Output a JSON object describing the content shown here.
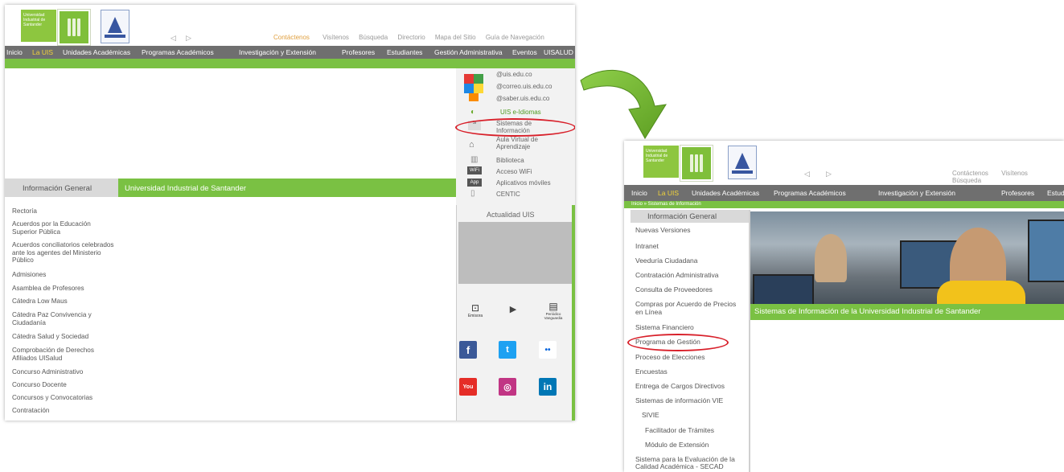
{
  "left": {
    "logo_text": "Universidad Industrial de Santander",
    "top_links": [
      "Contáctenos",
      "Visítenos",
      "Búsqueda",
      "Directorio",
      "Mapa del Sitio",
      "Guía de Navegación"
    ],
    "nav_items": [
      "Inicio",
      "La UIS",
      "Unidades Académicas",
      "Programas Académicos",
      "Investigación y Extensión",
      "Profesores",
      "Estudiantes",
      "Gestión Administrativa",
      "Eventos",
      "UISALUD"
    ],
    "side_title": "Información General",
    "main_title": "Universidad Industrial de Santander",
    "side_items": [
      "Rectoría",
      "Acuerdos por la Educación Superior Pública",
      "Acuerdos conciliatorios celebrados ante los agentes del Ministerio Público",
      "Admisiones",
      "Asamblea de Profesores",
      "Cátedra Low Maus",
      "Cátedra Paz Convivencia y Ciudadanía",
      "Cátedra Salud y Sociedad",
      "Comprobación de Derechos Afiliados UISalud",
      "Concurso Administrativo",
      "Concurso Docente",
      "Concursos y Convocatorias",
      "Contratación"
    ],
    "right_links": [
      "@uis.edu.co",
      "@correo.uis.edu.co",
      "@saber.uis.edu.co",
      "UIS e-Idiomas",
      "Sistemas de Información",
      "Aula Virtual de Aprendizaje",
      "Biblioteca",
      "Acceso WiFi",
      "Aplicativos móviles",
      "CENTIC"
    ],
    "actualidad": "Actualidad UIS",
    "media_labels": [
      "Emisora",
      "",
      "Periódico Vanguardia"
    ]
  },
  "right": {
    "logo_text": "Universidad Industrial de Santander",
    "top_links": [
      "Contáctenos",
      "Visítenos",
      "Búsqueda"
    ],
    "nav_items": [
      "Inicio",
      "La UIS",
      "Unidades Académicas",
      "Programas Académicos",
      "Investigación y Extensión",
      "Profesores",
      "Estudia"
    ],
    "breadcrumb": "Inicio » Sistemas de Información",
    "side_title": "Información General",
    "banner_caption": "Sistemas de Información de la Universidad Industrial de Santander",
    "side_items": [
      "Nuevas Versiones",
      "Intranet",
      "Veeduría Ciudadana",
      "Contratación Administrativa",
      "Consulta de Proveedores",
      "Compras por Acuerdo de Precios en Línea",
      "Sistema Financiero",
      "Programa de Gestión",
      "Proceso de Elecciones",
      "Encuestas",
      "Entrega de Cargos Directivos",
      "Sistemas de información VIE",
      "SIVIE",
      "Facilitador de Trámites",
      "Módulo de Extensión",
      "Sistema para la Evaluación de la Calidad Académica - SECAD"
    ]
  },
  "colors": {
    "green": "#7ac143",
    "gray": "#6f6f6f",
    "highlight": "#d8202a",
    "arrow": "#6aaa2a"
  }
}
